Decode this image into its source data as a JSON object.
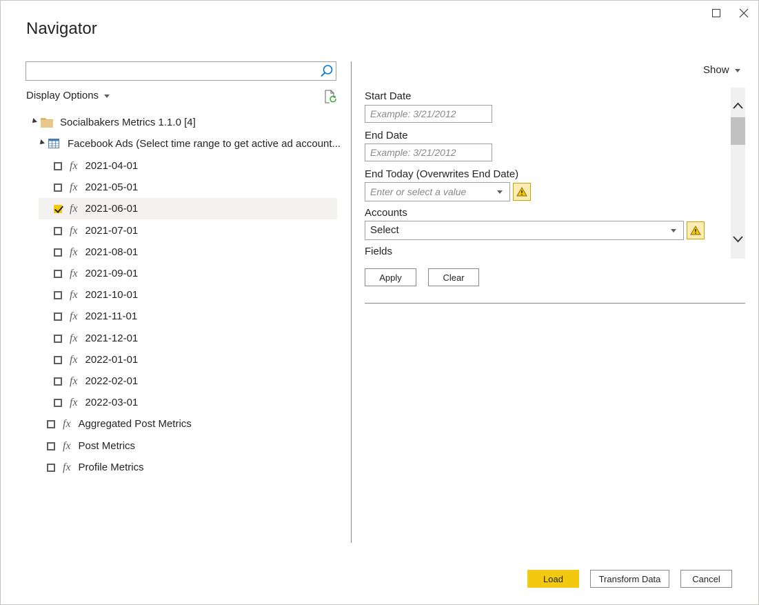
{
  "window": {
    "title": "Navigator"
  },
  "search": {
    "value": "",
    "placeholder": ""
  },
  "display_options": {
    "label": "Display Options"
  },
  "tree": {
    "root": {
      "label": "Socialbakers Metrics 1.1.0 [4]"
    },
    "table": {
      "label": "Facebook Ads (Select time range to get active ad account..."
    },
    "dates": [
      {
        "label": "2021-04-01",
        "checked": false
      },
      {
        "label": "2021-05-01",
        "checked": false
      },
      {
        "label": "2021-06-01",
        "checked": true
      },
      {
        "label": "2021-07-01",
        "checked": false
      },
      {
        "label": "2021-08-01",
        "checked": false
      },
      {
        "label": "2021-09-01",
        "checked": false
      },
      {
        "label": "2021-10-01",
        "checked": false
      },
      {
        "label": "2021-11-01",
        "checked": false
      },
      {
        "label": "2021-12-01",
        "checked": false
      },
      {
        "label": "2022-01-01",
        "checked": false
      },
      {
        "label": "2022-02-01",
        "checked": false
      },
      {
        "label": "2022-03-01",
        "checked": false
      }
    ],
    "functions": [
      {
        "label": "Aggregated Post Metrics",
        "checked": false
      },
      {
        "label": "Post Metrics",
        "checked": false
      },
      {
        "label": "Profile Metrics",
        "checked": false
      }
    ],
    "fx_symbol": "fx"
  },
  "right": {
    "show_label": "Show",
    "start_date": {
      "label": "Start Date",
      "placeholder": "Example: 3/21/2012"
    },
    "end_date": {
      "label": "End Date",
      "placeholder": "Example: 3/21/2012"
    },
    "end_today": {
      "label": "End Today (Overwrites End Date)",
      "placeholder": "Enter or select a value"
    },
    "accounts": {
      "label": "Accounts",
      "value": "Select"
    },
    "fields": {
      "label": "Fields"
    },
    "apply_label": "Apply",
    "clear_label": "Clear"
  },
  "footer": {
    "load_label": "Load",
    "transform_label": "Transform Data",
    "cancel_label": "Cancel"
  },
  "colors": {
    "accent": "#f2c811",
    "warning_bg": "#fbecb5"
  }
}
